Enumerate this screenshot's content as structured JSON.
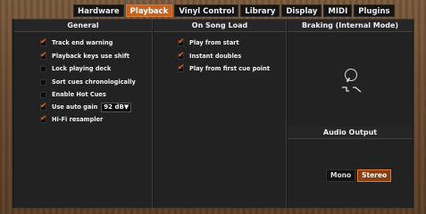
{
  "tabs": [
    "Hardware",
    "Playback",
    "Vinyl Control",
    "Library",
    "Display",
    "MIDI",
    "Plugins"
  ],
  "active_tab": "Playback",
  "general": {
    "title": "General",
    "options": [
      {
        "label": "Track end warning",
        "checked": true
      },
      {
        "label": "Playback keys use shift",
        "checked": true
      },
      {
        "label": "Lock playing deck",
        "checked": false
      },
      {
        "label": "Sort cues chronologically",
        "checked": false
      },
      {
        "label": "Enable Hot Cues",
        "checked": false
      },
      {
        "label": "Use auto gain",
        "checked": true
      },
      {
        "label": "Hi-Fi resampler",
        "checked": true
      }
    ],
    "auto_gain_value": "92 dB▼"
  },
  "song_load": {
    "title": "On Song Load",
    "options": [
      {
        "label": "Play from start",
        "checked": true
      },
      {
        "label": "Instant doubles",
        "checked": true
      },
      {
        "label": "Play from first cue point",
        "checked": true
      }
    ]
  },
  "braking": {
    "title": "Braking (Internal Mode)",
    "symbol": "⌐⌐"
  },
  "audio_output": {
    "title": "Audio Output",
    "options": [
      "Mono",
      "Stereo"
    ],
    "selected": "Stereo"
  },
  "colors": {
    "accent": "#c9621f",
    "background": "#222222"
  }
}
